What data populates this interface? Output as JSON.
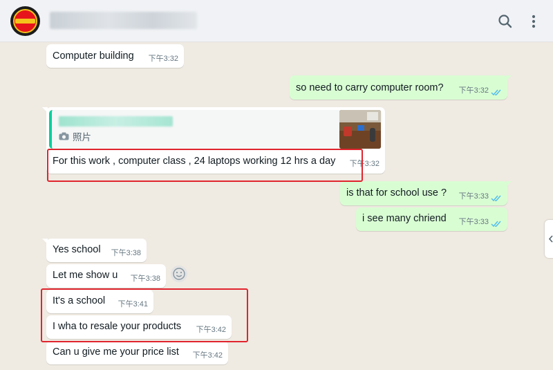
{
  "header": {
    "contact_name": "",
    "icons": {
      "search": "search-icon",
      "menu": "kebab-menu-icon"
    }
  },
  "messages": [
    {
      "direction": "in",
      "text": "Computer building",
      "time": "下午3:32"
    },
    {
      "direction": "out",
      "text": "so need to carry computer room?",
      "time": "下午3:32",
      "status": "read"
    },
    {
      "direction": "in",
      "reply_to": {
        "sender": "",
        "label": "照片",
        "type": "photo"
      },
      "text": "For this work , computer class , 24 laptops working 12 hrs a day",
      "time": "下午3:32",
      "highlighted": true
    },
    {
      "direction": "out",
      "text": "is that for school use ?",
      "time": "下午3:33",
      "status": "read"
    },
    {
      "direction": "out",
      "text": "i see many chriend",
      "time": "下午3:33",
      "status": "read"
    },
    {
      "direction": "in",
      "text": "Yes school",
      "time": "下午3:38"
    },
    {
      "direction": "in",
      "text": "Let me show u",
      "time": "下午3:38"
    },
    {
      "direction": "in",
      "text": "It's a school",
      "time": "下午3:41",
      "highlighted": true
    },
    {
      "direction": "in",
      "text": "I wha to resale your products",
      "time": "下午3:42",
      "highlighted": true
    },
    {
      "direction": "in",
      "text": "Can u give me your price list",
      "time": "下午3:42"
    }
  ],
  "colors": {
    "header_bg": "#f0f2f5",
    "chat_bg": "#efeae2",
    "incoming_bubble": "#ffffff",
    "outgoing_bubble": "#d9fdd3",
    "read_ticks": "#53bdeb",
    "highlight_box": "#e0242d",
    "quote_bar": "#06cf9c"
  }
}
